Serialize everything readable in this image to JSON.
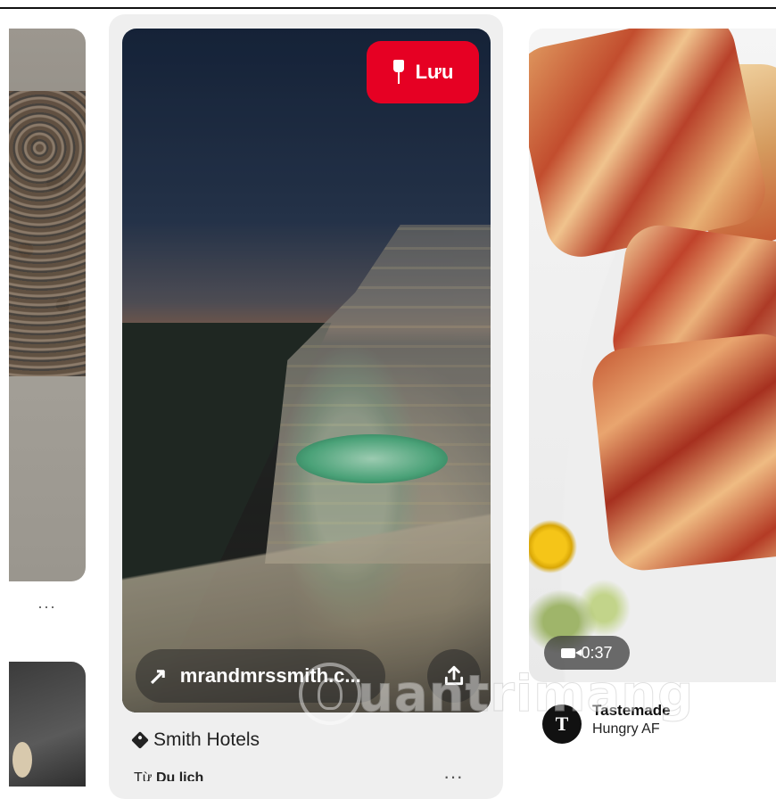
{
  "colors": {
    "save": "#e60023",
    "card_hover": "#efefef"
  },
  "left_column": {
    "more_label": "···"
  },
  "middle_pin": {
    "save_label": "Lưu",
    "link_text": "mrandmrssmith.c...",
    "tag_label": "Smith Hotels",
    "from_prefix": "Từ",
    "from_board": "Du lịch",
    "more_label": "···"
  },
  "right_pin": {
    "video_duration": "0:37",
    "avatar_letter": "T",
    "creator_name": "Tastemade",
    "board_name": "Hungry AF"
  },
  "watermark": {
    "text": "uantrimang"
  }
}
